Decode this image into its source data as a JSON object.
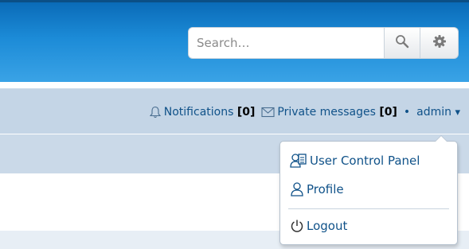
{
  "search": {
    "placeholder": "Search…"
  },
  "nav": {
    "notifications_label": "Notifications",
    "notifications_count": "[0]",
    "messages_label": "Private messages",
    "messages_count": "[0]",
    "separator": "•",
    "username": "admin",
    "caret": "▾"
  },
  "user_menu": {
    "items": [
      {
        "label": "User Control Panel",
        "icon": "user-control-panel-icon"
      },
      {
        "label": "Profile",
        "icon": "user-icon"
      },
      {
        "label": "Logout",
        "icon": "power-icon"
      }
    ]
  },
  "colors": {
    "header_blue": "#1c8bd7",
    "navbar_bg": "#c4d5e6",
    "link_color": "#105289"
  }
}
